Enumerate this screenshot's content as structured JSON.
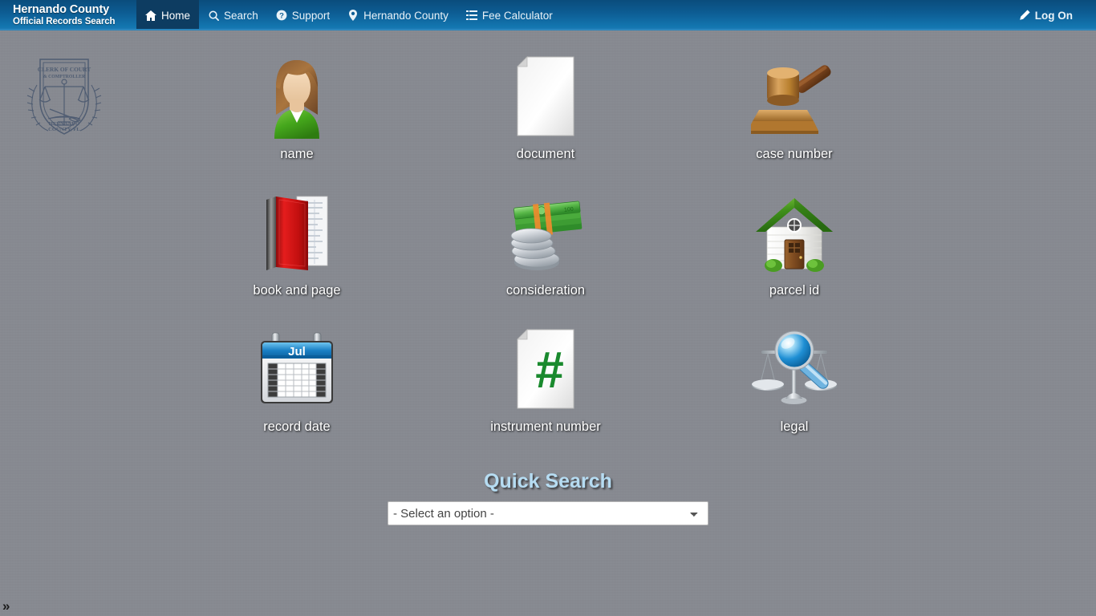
{
  "navbar": {
    "brand_line1": "Hernando County",
    "brand_line2": "Official Records Search",
    "items": [
      {
        "label": "Home",
        "icon": "home-icon",
        "active": true
      },
      {
        "label": "Search",
        "icon": "search-icon",
        "active": false
      },
      {
        "label": "Support",
        "icon": "question-circle-icon",
        "active": false
      },
      {
        "label": "Hernando County",
        "icon": "map-marker-icon",
        "active": false
      },
      {
        "label": "Fee Calculator",
        "icon": "list-icon",
        "active": false
      }
    ],
    "log_on": {
      "label": "Log On",
      "icon": "pencil-icon"
    }
  },
  "seal": {
    "line1": "CLERK OF COURT",
    "line2": "& COMPTROLLER",
    "line3": "HERNANDO",
    "line4": "COUNTY, FL"
  },
  "tiles": [
    {
      "label": "name",
      "icon": "person-icon"
    },
    {
      "label": "document",
      "icon": "document-icon"
    },
    {
      "label": "case number",
      "icon": "gavel-icon"
    },
    {
      "label": "book and page",
      "icon": "book-icon"
    },
    {
      "label": "consideration",
      "icon": "money-icon"
    },
    {
      "label": "parcel id",
      "icon": "house-icon"
    },
    {
      "label": "record date",
      "icon": "calendar-icon"
    },
    {
      "label": "instrument number",
      "icon": "hash-document-icon"
    },
    {
      "label": "legal",
      "icon": "scales-magnifier-icon"
    }
  ],
  "calendar": {
    "month": "Jul"
  },
  "quick_search": {
    "title": "Quick Search",
    "selected_option": "- Select an option -",
    "options": [
      "- Select an option -"
    ]
  },
  "footer": {
    "toggle_label": "»"
  },
  "colors": {
    "page_background": "#878a91",
    "navbar_top": "#0a4c7c",
    "navbar_bottom": "#2280b8",
    "navbar_active": "#0d3c61",
    "quick_search_title": "#b6dcf2",
    "tile_label": "#ffffff"
  }
}
